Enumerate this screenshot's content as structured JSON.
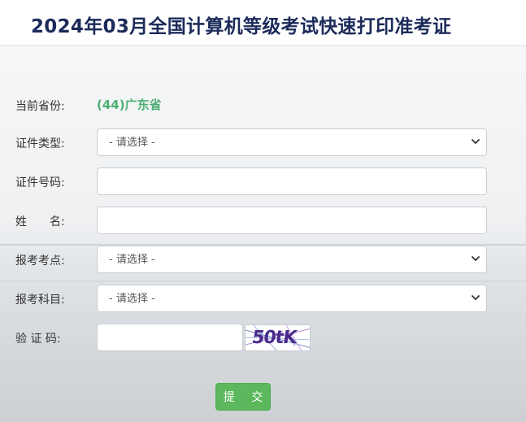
{
  "header": {
    "title": "2024年03月全国计算机等级考试快速打印准考证"
  },
  "form": {
    "province": {
      "label": "当前省份:",
      "value": "(44)广东省"
    },
    "id_type": {
      "label": "证件类型:",
      "selected": "- 请选择 -"
    },
    "id_number": {
      "label": "证件号码:",
      "value": ""
    },
    "name": {
      "label": "姓　　名:",
      "value": ""
    },
    "exam_site": {
      "label": "报考考点:",
      "selected": "- 请选择 -"
    },
    "exam_subject": {
      "label": "报考科目:",
      "selected": "- 请选择 -"
    },
    "captcha": {
      "label": "验 证 码:",
      "value": "",
      "image_text": "50tK"
    },
    "submit_label": "提 交"
  },
  "colors": {
    "title": "#1c2b5a",
    "province_value": "#4cae72",
    "submit_bg": "#5cb85c"
  }
}
